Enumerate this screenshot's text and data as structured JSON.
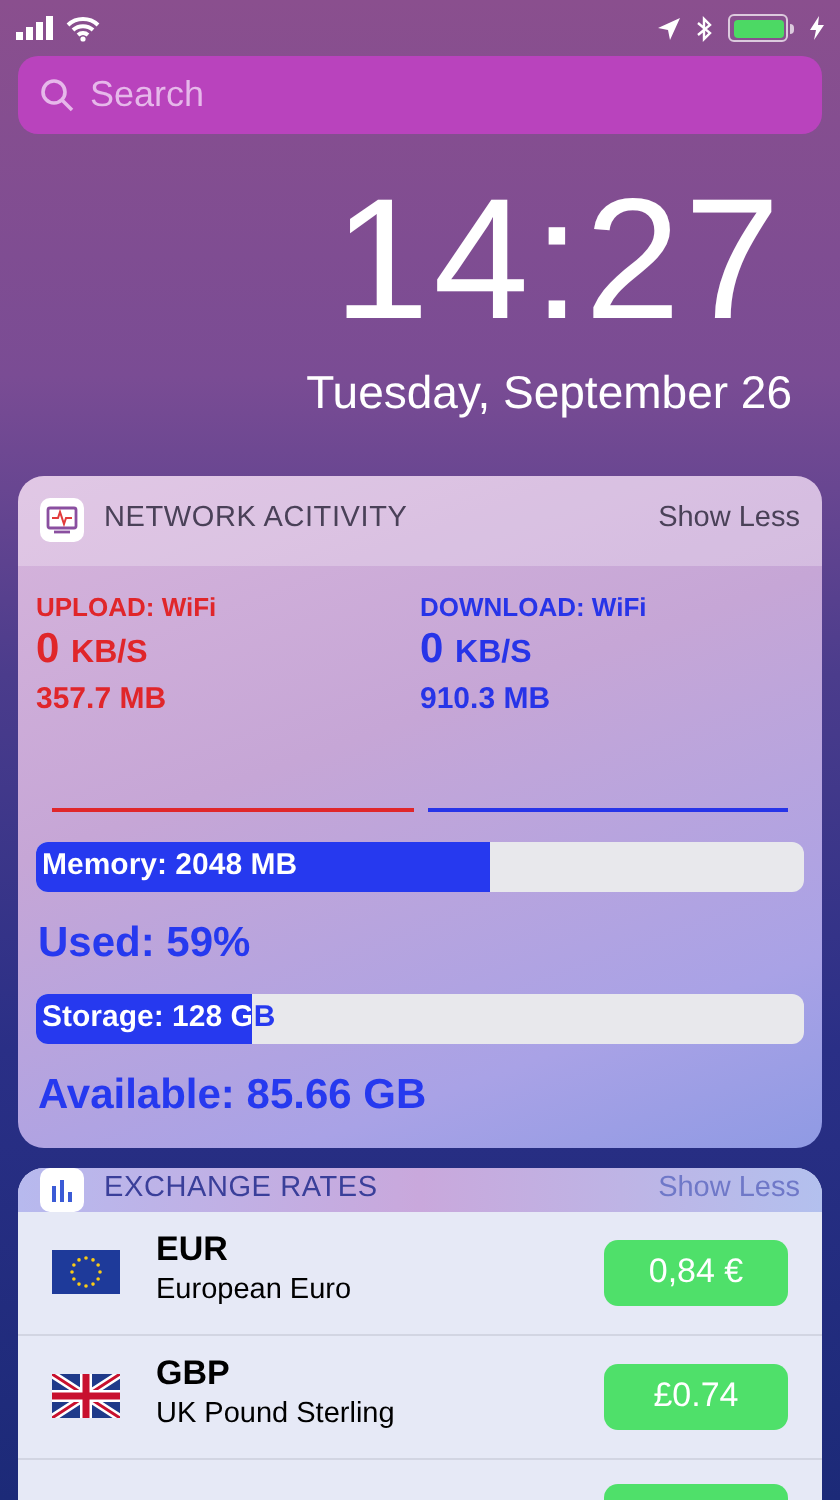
{
  "search": {
    "placeholder": "Search"
  },
  "clock": {
    "time": "14:27",
    "date": "Tuesday, September 26"
  },
  "network_widget": {
    "title": "NETWORK ACITIVITY",
    "action": "Show Less",
    "upload": {
      "label": "UPLOAD: WiFi",
      "rate": "0",
      "unit": "KB/S",
      "total": "357.7 MB"
    },
    "download": {
      "label": "DOWNLOAD: WiFi",
      "rate": "0",
      "unit": "KB/S",
      "total": "910.3 MB"
    },
    "memory": {
      "label": "Memory: 2048 MB",
      "level": 0.59,
      "reading": "Used: 59%"
    },
    "storage": {
      "label": "Storage: 128 GB",
      "level": 0.28,
      "reading": "Available: 85.66 GB"
    }
  },
  "exchange_widget": {
    "title": "EXCHANGE RATES",
    "action": "Show Less",
    "rates": [
      {
        "code": "EUR",
        "name": "European Euro",
        "value": "0,84 €",
        "kind": "eu"
      },
      {
        "code": "GBP",
        "name": "UK Pound Sterling",
        "value": "£0.74",
        "kind": "uk"
      }
    ]
  }
}
